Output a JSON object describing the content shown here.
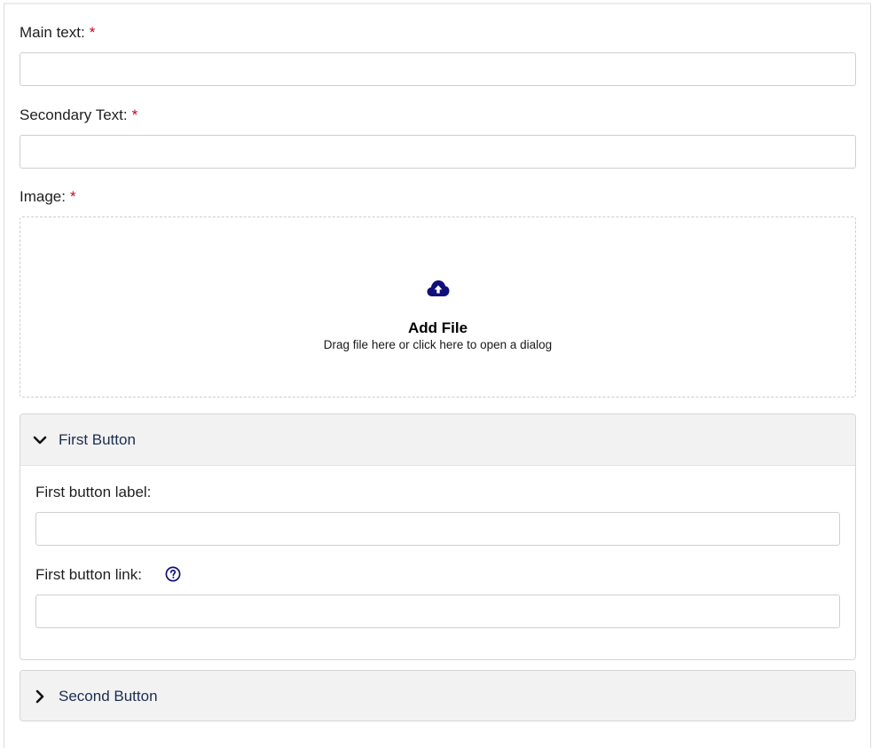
{
  "form": {
    "main_text": {
      "label": "Main text:",
      "required_mark": "*",
      "value": ""
    },
    "secondary_text": {
      "label": "Secondary Text:",
      "required_mark": "*",
      "value": ""
    },
    "image": {
      "label": "Image:",
      "required_mark": "*",
      "dropzone": {
        "icon": "cloud-upload-icon",
        "title": "Add File",
        "subtitle": "Drag file here or click here to open a dialog"
      }
    }
  },
  "accordions": [
    {
      "title": "First Button",
      "expanded": true,
      "chevron_icon": "chevron-down-icon",
      "fields": {
        "label_field": {
          "label": "First button label:",
          "value": ""
        },
        "link_field": {
          "label": "First button link:",
          "value": "",
          "help_icon": "question-circle-icon"
        }
      }
    },
    {
      "title": "Second Button",
      "expanded": false,
      "chevron_icon": "chevron-right-icon"
    }
  ],
  "colors": {
    "required": "#d0021b",
    "accent_icon": "#10107a",
    "accordion_header_bg": "#f2f2f2",
    "accordion_title": "#1c2d4f",
    "border": "#cfcfcf"
  }
}
